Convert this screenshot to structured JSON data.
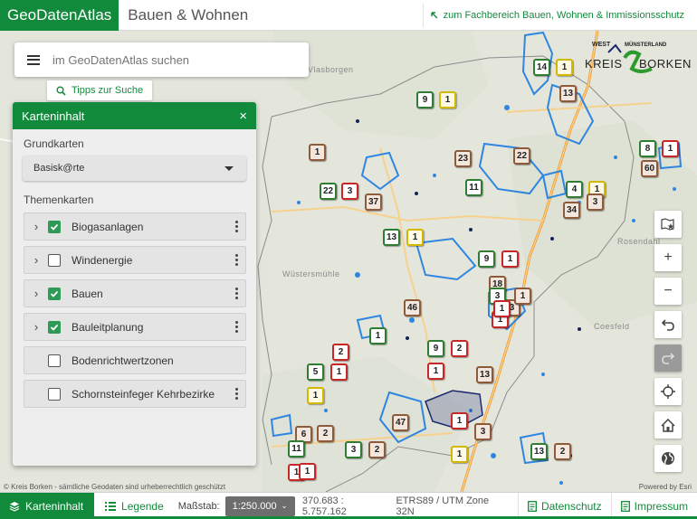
{
  "header": {
    "brand": "GeoDatenAtlas",
    "subtitle": "Bauen & Wohnen",
    "fach_link": "zum Fachbereich Bauen, Wohnen & Immissionsschutz"
  },
  "search": {
    "placeholder": "im GeoDatenAtlas suchen",
    "tips_label": "Tipps zur Suche"
  },
  "logo": {
    "west": "WEST",
    "muensterland": "MÜNSTERLAND",
    "kreis": "KREIS",
    "borken": "BORKEN"
  },
  "panel": {
    "title": "Karteninhalt",
    "close": "×",
    "grundkarten_label": "Grundkarten",
    "basemap_value": "Basisk@rte",
    "themenkarten_label": "Themenkarten",
    "layers": [
      {
        "label": "Biogasanlagen",
        "checked": true,
        "expandable": true
      },
      {
        "label": "Windenergie",
        "checked": false,
        "expandable": true
      },
      {
        "label": "Bauen",
        "checked": true,
        "expandable": true
      },
      {
        "label": "Bauleitplanung",
        "checked": true,
        "expandable": true
      },
      {
        "label": "Bodenrichtwertzonen",
        "checked": false,
        "expandable": false
      },
      {
        "label": "Schornsteinfeger Kehrbezirke",
        "checked": false,
        "expandable": false
      }
    ]
  },
  "map": {
    "towns": [
      "Rosendahl",
      "Coesfeld",
      "Wüstersmühle",
      "Vlasborgen"
    ],
    "markers": [
      "14",
      "1",
      "13",
      "9",
      "1",
      "23",
      "22",
      "11",
      "8",
      "1",
      "60",
      "22",
      "3",
      "37",
      "4",
      "1",
      "34",
      "3",
      "13",
      "1",
      "9",
      "1",
      "46",
      "3",
      "1",
      "9",
      "2",
      "5",
      "1",
      "1",
      "13",
      "47",
      "6",
      "3",
      "2",
      "1",
      "11",
      "1",
      "13",
      "2",
      "1",
      "2",
      "1",
      "3",
      "1",
      "1",
      "1",
      "18",
      "3",
      "1",
      "2",
      "1"
    ]
  },
  "attribution": {
    "left": "© Kreis Borken - sämtliche Geodaten sind urheberrechtlich geschützt",
    "right": "Powered by Esri"
  },
  "footer": {
    "karteninhalt": "Karteninhalt",
    "legende": "Legende",
    "massstab_label": "Maßstab:",
    "scale_value": "1:250.000",
    "coords": "370.683 : 5.757.162",
    "srs": "ETRS89 / UTM Zone 32N",
    "datenschutz": "Datenschutz",
    "impressum": "Impressum"
  },
  "colors": {
    "brand_green": "#128a3c",
    "water_blue": "#2f86e0",
    "road_orange": "#f0a23a"
  }
}
